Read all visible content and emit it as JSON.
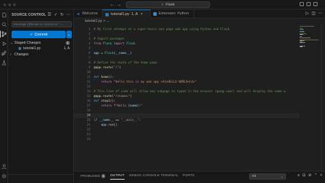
{
  "titlebar": {
    "search_text": "Flask"
  },
  "sidebar": {
    "header": "SOURCE CONTROL",
    "message_placeholder": "Message (⌘Enter to commit on \"...",
    "commit_label": "Commit",
    "staged": {
      "label": "Staged Changes",
      "count": "1"
    },
    "staged_file": {
      "name": "tutorial1.py",
      "status": "1, A"
    },
    "changes": {
      "label": "Changes"
    }
  },
  "tabs": [
    {
      "label": "Welcome"
    },
    {
      "label": "tutorial1.py",
      "status": "1, A"
    },
    {
      "label": "Extension: Python"
    }
  ],
  "breadcrumb": "tutorial1.py > ...",
  "code": [
    {
      "n": "1",
      "tokens": [
        {
          "t": "# My first attempt at a super-basic one page web app using Python and Flask",
          "c": "comment"
        }
      ]
    },
    {
      "n": "2",
      "tokens": []
    },
    {
      "n": "3",
      "tokens": [
        {
          "t": "# Import packages",
          "c": "comment"
        }
      ]
    },
    {
      "n": "4",
      "tokens": [
        {
          "t": "from ",
          "c": "keyword"
        },
        {
          "t": "flask ",
          "c": "class"
        },
        {
          "t": "import ",
          "c": "keyword"
        },
        {
          "t": "Flask",
          "c": "class"
        }
      ]
    },
    {
      "n": "5",
      "tokens": []
    },
    {
      "n": "6",
      "tokens": [
        {
          "t": "app",
          "c": "name"
        },
        {
          "t": " = ",
          "c": "plain"
        },
        {
          "t": "Flask",
          "c": "class"
        },
        {
          "t": "(",
          "c": "plain"
        },
        {
          "t": "__name__",
          "c": "name"
        },
        {
          "t": ")",
          "c": "plain"
        }
      ]
    },
    {
      "n": "7",
      "tokens": []
    },
    {
      "n": "8",
      "tokens": [
        {
          "t": "# Define the route of the home page",
          "c": "comment"
        }
      ]
    },
    {
      "n": "9",
      "tokens": [
        {
          "t": "@app.route",
          "c": "decor"
        },
        {
          "t": "(",
          "c": "plain"
        },
        {
          "t": "\"/\"",
          "c": "string"
        },
        {
          "t": ")",
          "c": "plain"
        }
      ]
    },
    {
      "n": "10",
      "tokens": []
    },
    {
      "n": "11",
      "tokens": [
        {
          "t": "def ",
          "c": "def"
        },
        {
          "t": "home",
          "c": "func"
        },
        {
          "t": "():",
          "c": "plain"
        }
      ]
    },
    {
      "n": "12",
      "tokens": [
        {
          "t": "    return ",
          "c": "keyword"
        },
        {
          "t": "\"Hello this is my web app <h1>HELLO WORLD<h1>\"",
          "c": "string"
        }
      ]
    },
    {
      "n": "13",
      "tokens": []
    },
    {
      "n": "14",
      "tokens": [
        {
          "t": "# This line of code will allow any subpage to typed in the browser (goog.com/) and will display the name w",
          "c": "comment"
        }
      ]
    },
    {
      "n": "15",
      "tokens": [
        {
          "t": "@app.route",
          "c": "decor"
        },
        {
          "t": "(",
          "c": "plain"
        },
        {
          "t": "\"/<name>\"",
          "c": "string"
        },
        {
          "t": ")",
          "c": "plain"
        }
      ]
    },
    {
      "n": "16",
      "tokens": [
        {
          "t": "def ",
          "c": "def"
        },
        {
          "t": "step1",
          "c": "func"
        },
        {
          "t": "():",
          "c": "plain"
        }
      ]
    },
    {
      "n": "17",
      "tokens": [
        {
          "t": "    return ",
          "c": "keyword"
        },
        {
          "t": "f\"Hello ",
          "c": "string"
        },
        {
          "t": "{name}",
          "c": "name"
        },
        {
          "t": "!\"",
          "c": "string"
        }
      ]
    },
    {
      "n": "18",
      "tokens": []
    },
    {
      "n": "19",
      "tokens": [],
      "current": true
    },
    {
      "n": "20",
      "tokens": [
        {
          "t": "if ",
          "c": "keyword"
        },
        {
          "t": "__name__",
          "c": "name"
        },
        {
          "t": " == ",
          "c": "plain"
        },
        {
          "t": "\"__main__\"",
          "c": "string"
        },
        {
          "t": ":",
          "c": "plain"
        }
      ]
    },
    {
      "n": "21",
      "tokens": [
        {
          "t": "    app",
          "c": "name"
        },
        {
          "t": ".",
          "c": "plain"
        },
        {
          "t": "run",
          "c": "func"
        },
        {
          "t": "()",
          "c": "plain"
        }
      ]
    },
    {
      "n": "22",
      "tokens": []
    },
    {
      "n": "23",
      "tokens": []
    },
    {
      "n": "24",
      "tokens": []
    }
  ],
  "panel": {
    "tabs": [
      {
        "label": "PROBLEMS",
        "badge": "1"
      },
      {
        "label": "OUTPUT",
        "active": true
      },
      {
        "label": "DEBUG CONSOLE"
      },
      {
        "label": "TERMINAL"
      },
      {
        "label": "PORTS"
      }
    ],
    "output_channel": "Git"
  },
  "icons": {
    "activity": [
      "explorer-icon",
      "search-icon",
      "source-control-icon",
      "run-debug-icon",
      "extensions-icon",
      "testing-icon"
    ]
  },
  "colors": {
    "accent": "#0078d4",
    "editor_bg": "#1f1f1f",
    "sidebar_bg": "#181818",
    "modified": "#e2c08d"
  }
}
